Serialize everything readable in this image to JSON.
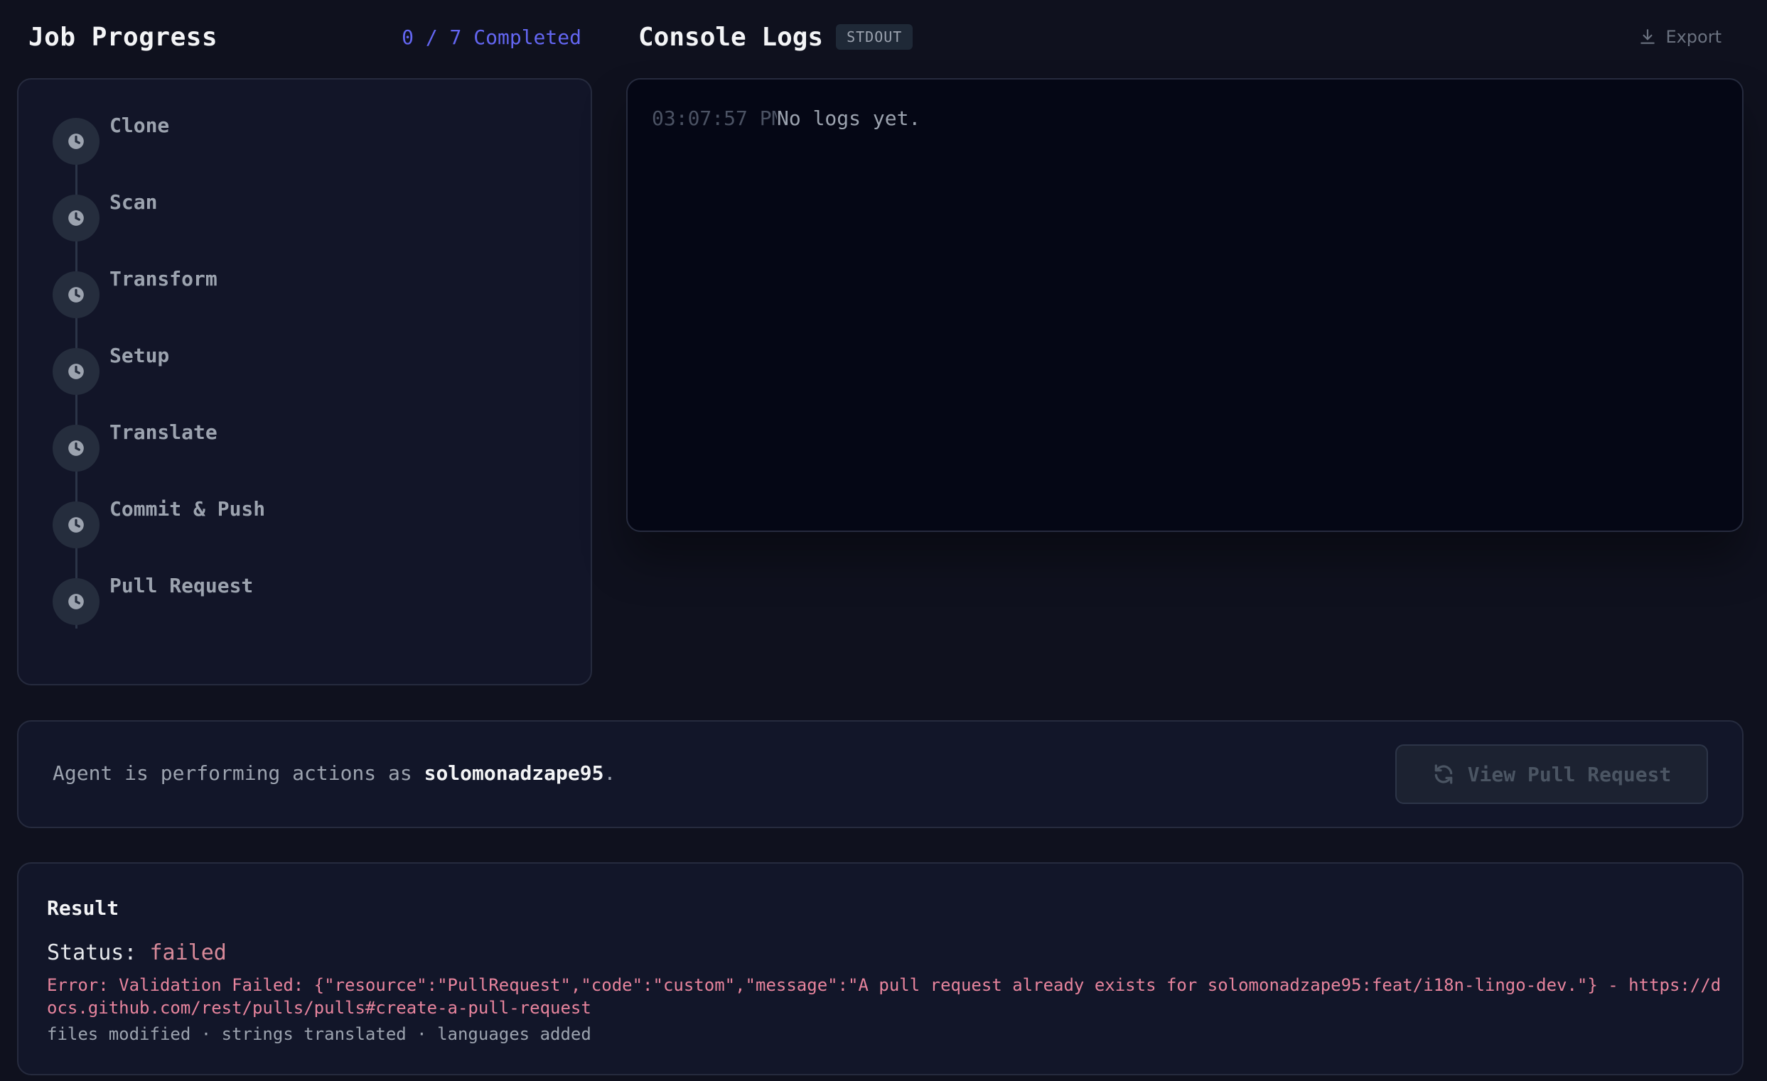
{
  "job_progress": {
    "title": "Job Progress",
    "completed": "0 / 7 Completed",
    "steps": [
      {
        "label": "Clone",
        "status_icon": "clock-icon"
      },
      {
        "label": "Scan",
        "status_icon": "clock-icon"
      },
      {
        "label": "Transform",
        "status_icon": "clock-icon"
      },
      {
        "label": "Setup",
        "status_icon": "clock-icon"
      },
      {
        "label": "Translate",
        "status_icon": "clock-icon"
      },
      {
        "label": "Commit & Push",
        "status_icon": "clock-icon"
      },
      {
        "label": "Pull Request",
        "status_icon": "clock-icon"
      }
    ]
  },
  "console": {
    "title": "Console Logs",
    "badge": "STDOUT",
    "export_label": "Export",
    "log_time": "03:07:57 PM",
    "log_message": "No logs yet."
  },
  "agent": {
    "prefix": "Agent is performing actions as ",
    "username": "solomonadzape95",
    "suffix": ".",
    "button_label": "View Pull Request"
  },
  "result": {
    "title": "Result",
    "status_label": "Status: ",
    "status_value": "failed",
    "error": "Error: Validation Failed: {\"resource\":\"PullRequest\",\"code\":\"custom\",\"message\":\"A pull request already exists for solomonadzape95:feat/i18n-lingo-dev.\"} - https://docs.github.com/rest/pulls/pulls#create-a-pull-request",
    "meta": "files modified · strings translated · languages added"
  },
  "colors": {
    "background": "#0f111e",
    "accent": "#6366f1",
    "error": "#e7849d"
  }
}
